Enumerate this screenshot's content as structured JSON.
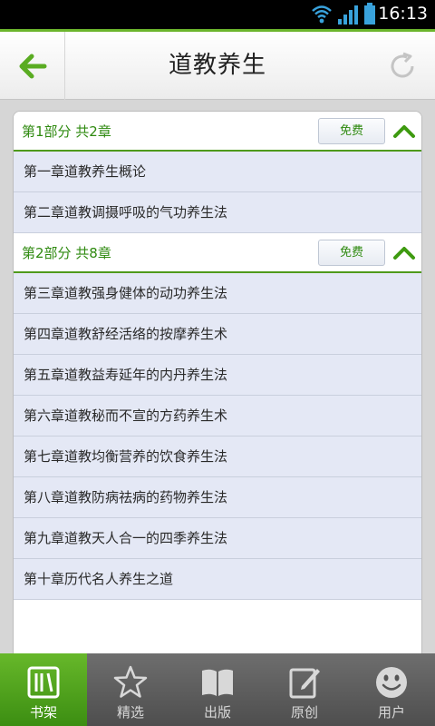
{
  "status": {
    "time": "16:13"
  },
  "header": {
    "title": "道教养生",
    "back_icon": "back-arrow-icon",
    "refresh_icon": "refresh-icon"
  },
  "sections": [
    {
      "title": "第1部分  共2章",
      "badge": "免费",
      "chapters": [
        "第一章道教养生概论",
        "第二章道教调摄呼吸的气功养生法"
      ]
    },
    {
      "title": "第2部分  共8章",
      "badge": "免费",
      "chapters": [
        "第三章道教强身健体的动功养生法",
        "第四章道教舒经活络的按摩养生术",
        "第五章道教益寿延年的内丹养生法",
        "第六章道教秘而不宣的方药养生术",
        "第七章道教均衡营养的饮食养生法",
        "第八章道教防病祛病的药物养生法",
        "第九章道教天人合一的四季养生法",
        "第十章历代名人养生之道"
      ]
    }
  ],
  "tabs": [
    {
      "label": "书架",
      "icon": "bookshelf-icon",
      "active": true
    },
    {
      "label": "精选",
      "icon": "star-icon",
      "active": false
    },
    {
      "label": "出版",
      "icon": "book-icon",
      "active": false
    },
    {
      "label": "原创",
      "icon": "edit-icon",
      "active": false
    },
    {
      "label": "用户",
      "icon": "smiley-icon",
      "active": false
    }
  ],
  "colors": {
    "accent": "#6cb52d",
    "section_text": "#2f8a10",
    "chapter_bg": "#e4e8f5"
  }
}
